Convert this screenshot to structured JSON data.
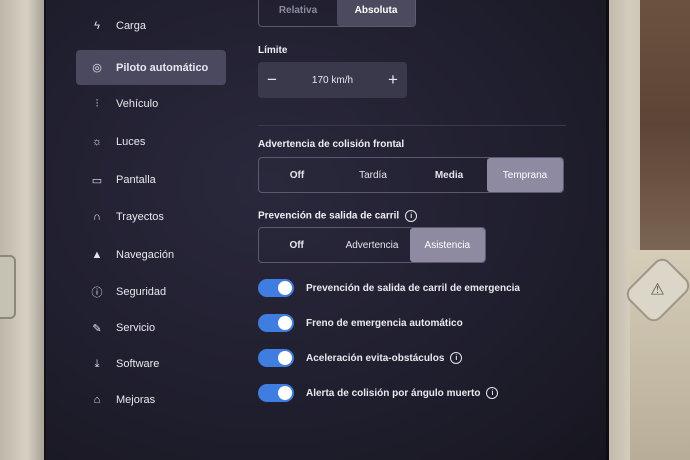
{
  "sidebar": {
    "items": [
      {
        "label": "Carga",
        "icon": "bolt-icon",
        "glyph": "ϟ",
        "active": false
      },
      {
        "label": "Piloto automático",
        "icon": "steering-wheel-icon",
        "glyph": "◎",
        "active": true
      },
      {
        "label": "Vehículo",
        "icon": "sliders-icon",
        "glyph": "⫶",
        "active": false
      },
      {
        "label": "Luces",
        "icon": "sun-icon",
        "glyph": "☼",
        "active": false
      },
      {
        "label": "Pantalla",
        "icon": "display-icon",
        "glyph": "▭",
        "active": false
      },
      {
        "label": "Trayectos",
        "icon": "route-icon",
        "glyph": "∩",
        "active": false
      },
      {
        "label": "Navegación",
        "icon": "navigation-arrow-icon",
        "glyph": "▲",
        "active": false
      },
      {
        "label": "Seguridad",
        "icon": "alert-circle-icon",
        "glyph": "ⓘ",
        "active": false
      },
      {
        "label": "Servicio",
        "icon": "wrench-icon",
        "glyph": "✎",
        "active": false
      },
      {
        "label": "Software",
        "icon": "download-icon",
        "glyph": "⤓",
        "active": false
      },
      {
        "label": "Mejoras",
        "icon": "bag-icon",
        "glyph": "⌂",
        "active": false
      }
    ]
  },
  "speed_mode": {
    "options": [
      "Relativa",
      "Absoluta"
    ],
    "selected": "Absoluta"
  },
  "limit": {
    "label": "Límite",
    "value": "170 km/h",
    "minus": "−",
    "plus": "+"
  },
  "collision_warning": {
    "label": "Advertencia de colisión frontal",
    "options": [
      "Off",
      "Tardía",
      "Media",
      "Temprana"
    ],
    "selected": "Temprana"
  },
  "lane_departure": {
    "label": "Prevención de salida de carril",
    "info": "i",
    "options": [
      "Off",
      "Advertencia",
      "Asistencia"
    ],
    "selected": "Asistencia"
  },
  "toggles": [
    {
      "label": "Prevención de salida de carril de emergencia",
      "on": true,
      "info": ""
    },
    {
      "label": "Freno de emergencia automático",
      "on": true,
      "info": ""
    },
    {
      "label": "Aceleración evita-obstáculos",
      "on": true,
      "info": "i"
    },
    {
      "label": "Alerta de colisión por ángulo muerto",
      "on": true,
      "info": "i"
    }
  ],
  "colors": {
    "toggle_on": "#3f7de0",
    "selected_segment": "#8e8aa2",
    "screen_bg": "#1f1e2d"
  }
}
